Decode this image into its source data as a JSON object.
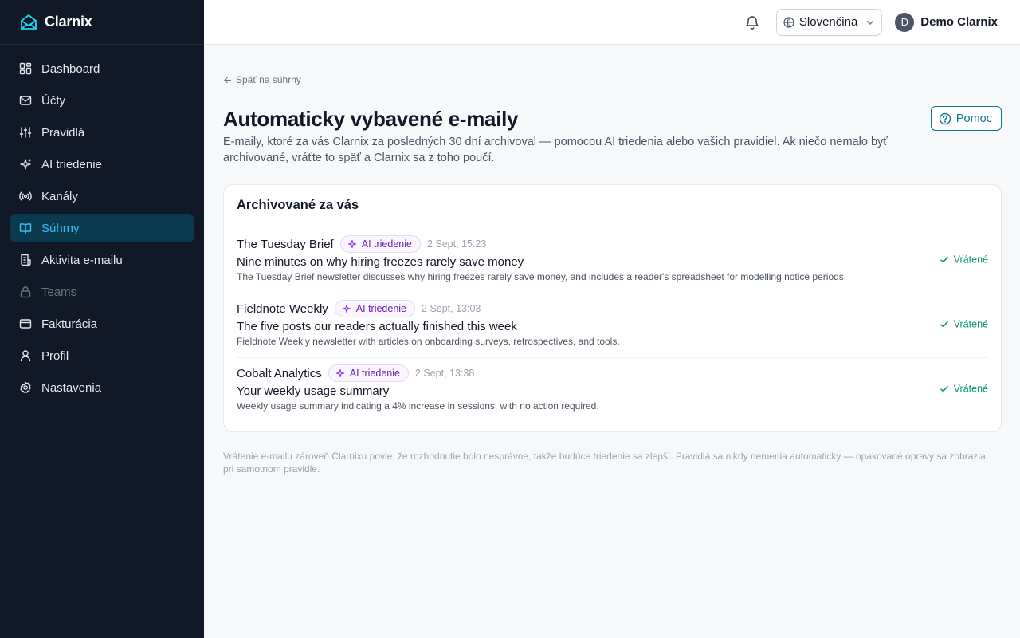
{
  "app": {
    "name": "Clarnix"
  },
  "sidebar": {
    "items": [
      {
        "label": "Dashboard",
        "icon": "dashboard-icon"
      },
      {
        "label": "Účty",
        "icon": "mail-icon"
      },
      {
        "label": "Pravidlá",
        "icon": "sliders-icon"
      },
      {
        "label": "AI triedenie",
        "icon": "sparkles-icon"
      },
      {
        "label": "Kanály",
        "icon": "broadcast-icon"
      },
      {
        "label": "Súhrny",
        "icon": "book-open-icon",
        "active": true
      },
      {
        "label": "Aktivita e-mailu",
        "icon": "receipt-icon"
      },
      {
        "label": "Teams",
        "icon": "lock-icon",
        "disabled": true
      },
      {
        "label": "Fakturácia",
        "icon": "credit-card-icon"
      },
      {
        "label": "Profil",
        "icon": "user-icon"
      },
      {
        "label": "Nastavenia",
        "icon": "gear-icon"
      }
    ]
  },
  "topbar": {
    "language": "Slovenčina",
    "user_initial": "D",
    "user_name": "Demo Clarnix"
  },
  "page": {
    "back_label": "Späť na súhrny",
    "title": "Automaticky vybavené e-maily",
    "description": "E-maily, ktoré za vás Clarnix za posledných 30 dní archivoval — pomocou AI triedenia alebo vašich pravidiel. Ak niečo nemalo byť archivované, vráťte to späť a Clarnix sa z toho poučí.",
    "help_label": "Pomoc",
    "card_title": "Archivované za vás",
    "footnote": "Vrátenie e-mailu zároveň Clarnixu povie, že rozhodnutie bolo nesprávne, takže budúce triedenie sa zlepší. Pravidlá sa nikdy nemenia automaticky — opakované opravy sa zobrazia pri samotnom pravidle."
  },
  "emails": [
    {
      "sender": "The Tuesday Brief",
      "badge": "AI triedenie",
      "date": "2 Sept, 15:23",
      "subject": "Nine minutes on why hiring freezes rarely save money",
      "summary": "The Tuesday Brief newsletter discusses why hiring freezes rarely save money, and includes a reader's spreadsheet for modelling notice periods.",
      "status": "Vrátené"
    },
    {
      "sender": "Fieldnote Weekly",
      "badge": "AI triedenie",
      "date": "2 Sept, 13:03",
      "subject": "The five posts our readers actually finished this week",
      "summary": "Fieldnote Weekly newsletter with articles on onboarding surveys, retrospectives, and tools.",
      "status": "Vrátené"
    },
    {
      "sender": "Cobalt Analytics",
      "badge": "AI triedenie",
      "date": "2 Sept, 13:38",
      "subject": "Your weekly usage summary",
      "summary": "Weekly usage summary indicating a 4% increase in sessions, with no action required.",
      "status": "Vrátené"
    }
  ],
  "colors": {
    "sidebar_bg": "#111827",
    "accent": "#0e7490",
    "active_text": "#38bdf8",
    "success": "#059669",
    "badge_purple": "#6b21a8"
  }
}
